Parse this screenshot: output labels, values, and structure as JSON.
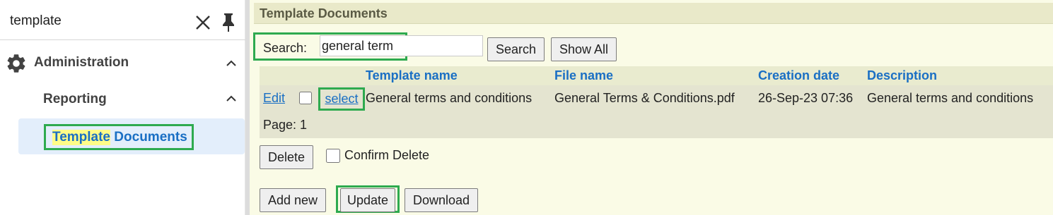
{
  "sidebar": {
    "search_value": "template",
    "section": {
      "label": "Administration"
    },
    "subsection": {
      "label": "Reporting"
    },
    "active_item": {
      "label_highlight": "Template",
      "label_rest": " Documents"
    }
  },
  "main": {
    "panel_title": "Template Documents",
    "search": {
      "label": "Search:",
      "value": "general term",
      "search_button": "Search",
      "show_all_button": "Show All"
    },
    "table": {
      "columns": [
        "Template name",
        "File name",
        "Creation date",
        "Description"
      ],
      "rows": [
        {
          "edit": "Edit",
          "select": "select",
          "template_name": "General terms and conditions",
          "file_name": "General Terms & Conditions.pdf",
          "creation_date": "26-Sep-23 07:36",
          "description": "General terms and conditions"
        }
      ],
      "pager": "Page: 1"
    },
    "delete_button": "Delete",
    "confirm_delete_label": "Confirm Delete",
    "add_new_button": "Add new",
    "update_button": "Update",
    "download_button": "Download"
  },
  "colors": {
    "accent_link": "#1a6fc4",
    "highlight_border": "#2eaa4f",
    "panel_bg": "#fafbe6",
    "search_highlight": "#fffc88"
  }
}
